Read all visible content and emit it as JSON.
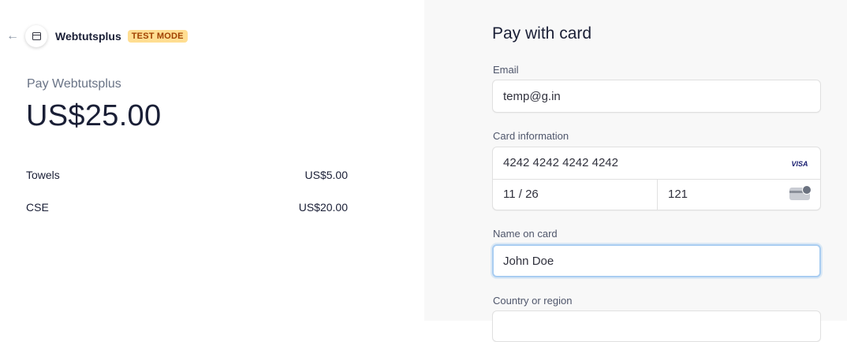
{
  "header": {
    "merchant_name": "Webtutsplus",
    "mode_badge": "TEST MODE"
  },
  "summary": {
    "pay_label": "Pay Webtutsplus",
    "total": "US$25.00",
    "line_items": [
      {
        "name": "Towels",
        "price": "US$5.00"
      },
      {
        "name": "CSE",
        "price": "US$20.00"
      }
    ]
  },
  "form": {
    "title": "Pay with card",
    "email_label": "Email",
    "email_value": "temp@g.in",
    "card_label": "Card information",
    "card_number": "4242 4242 4242 4242",
    "card_brand": "VISA",
    "card_expiry": "11 / 26",
    "card_cvc": "121",
    "name_label": "Name on card",
    "name_value": "John Doe",
    "country_label": "Country or region"
  },
  "icons": {
    "back": "arrow-left-icon",
    "merchant": "shop-icon",
    "card_brand": "visa-icon",
    "cvc": "cvc-card-icon"
  },
  "colors": {
    "badge_bg": "#ffde92",
    "badge_text": "#a04100",
    "focus_border": "#a9cdf1",
    "right_panel_bg": "#f8f8f8"
  }
}
